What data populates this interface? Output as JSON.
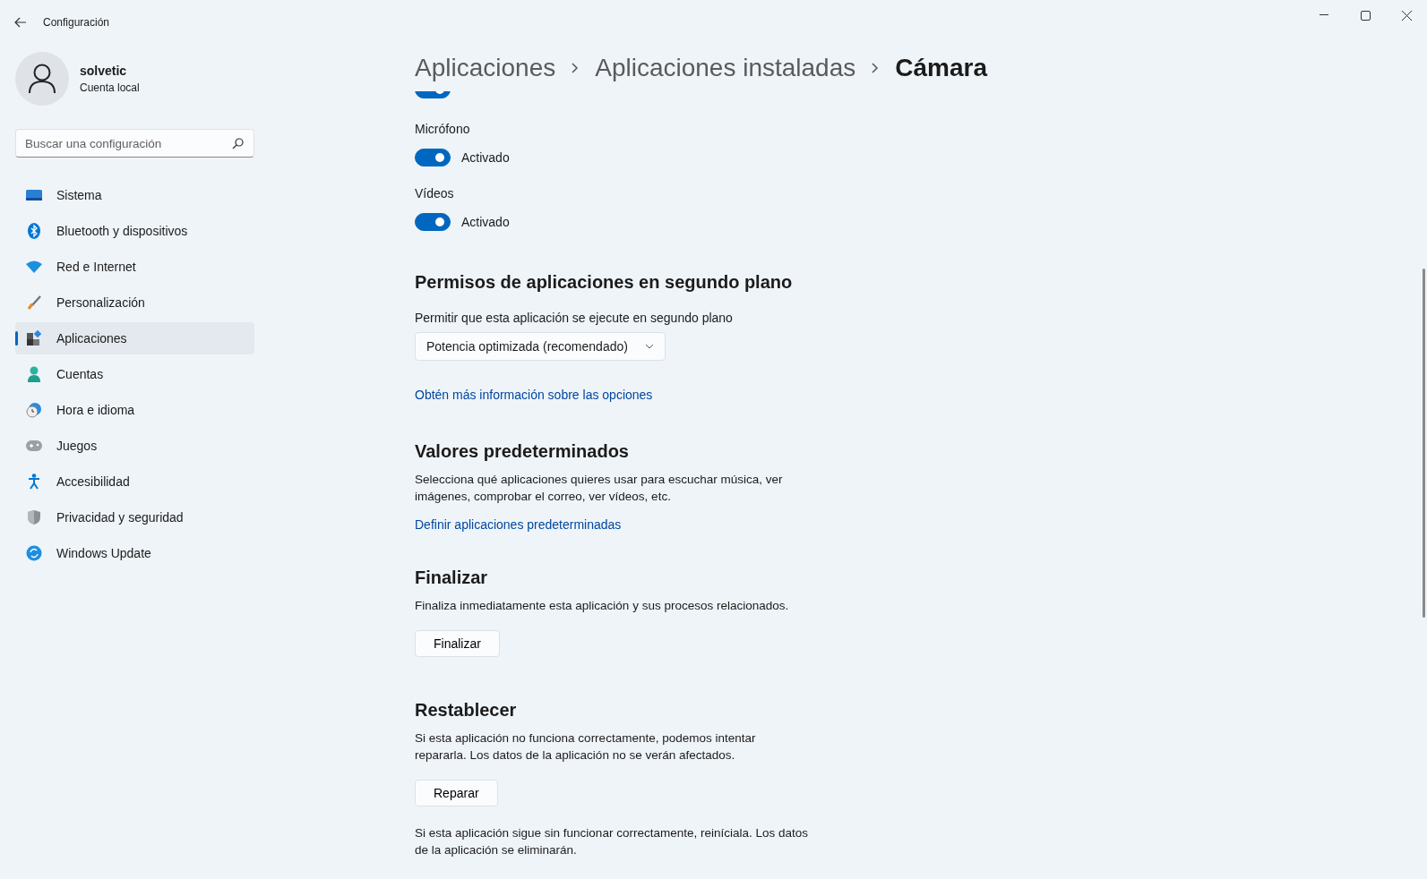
{
  "window": {
    "title": "Configuración"
  },
  "user": {
    "name": "solvetic",
    "account": "Cuenta local"
  },
  "search": {
    "placeholder": "Buscar una configuración"
  },
  "sidebar": {
    "items": [
      {
        "label": "Sistema",
        "kind": "system",
        "selected": false
      },
      {
        "label": "Bluetooth y dispositivos",
        "kind": "bluetooth",
        "selected": false
      },
      {
        "label": "Red e Internet",
        "kind": "wifi",
        "selected": false
      },
      {
        "label": "Personalización",
        "kind": "brush",
        "selected": false
      },
      {
        "label": "Aplicaciones",
        "kind": "apps",
        "selected": true
      },
      {
        "label": "Cuentas",
        "kind": "person",
        "selected": false
      },
      {
        "label": "Hora e idioma",
        "kind": "clock",
        "selected": false
      },
      {
        "label": "Juegos",
        "kind": "gamepad",
        "selected": false
      },
      {
        "label": "Accesibilidad",
        "kind": "accessibility",
        "selected": false
      },
      {
        "label": "Privacidad y seguridad",
        "kind": "shield",
        "selected": false
      },
      {
        "label": "Windows Update",
        "kind": "update",
        "selected": false
      }
    ]
  },
  "breadcrumb": [
    "Aplicaciones",
    "Aplicaciones instaladas",
    "Cámara"
  ],
  "permissions": [
    {
      "on": true
    },
    {
      "label": "Micrófono",
      "on": true,
      "state": "Activado"
    },
    {
      "label": "Vídeos",
      "on": true,
      "state": "Activado"
    }
  ],
  "background": {
    "title": "Permisos de aplicaciones en segundo plano",
    "label": "Permitir que esta aplicación se ejecute en segundo plano",
    "dropdown": {
      "value": "Potencia optimizada (recomendado)"
    },
    "link": "Obtén más información sobre las opciones"
  },
  "defaults": {
    "title": "Valores predeterminados",
    "description": "Selecciona qué aplicaciones quieres usar para escuchar música, ver imágenes, comprobar el correo, ver vídeos, etc.",
    "link": "Definir aplicaciones predeterminadas"
  },
  "terminate": {
    "title": "Finalizar",
    "description": "Finaliza inmediatamente esta aplicación y sus procesos relacionados.",
    "button": "Finalizar"
  },
  "reset": {
    "title": "Restablecer",
    "description": "Si esta aplicación no funciona correctamente, podemos intentar repararla. Los datos de la aplicación no se verán afectados.",
    "button": "Reparar",
    "note": "Si esta aplicación sigue sin funcionar correctamente, reiníciala. Los datos de la aplicación se eliminarán."
  }
}
